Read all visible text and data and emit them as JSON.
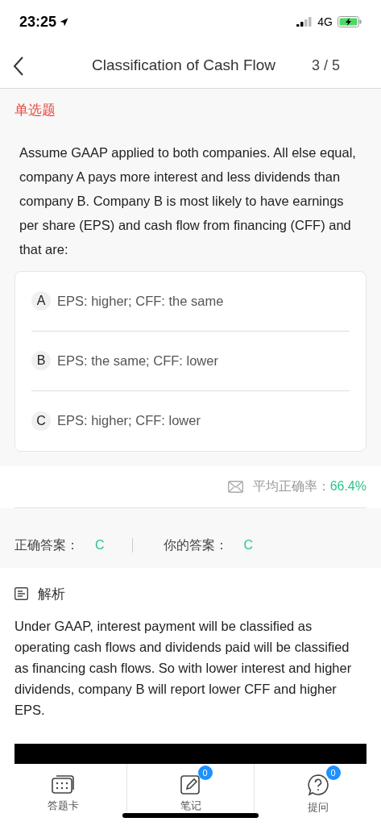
{
  "status_bar": {
    "time": "23:25",
    "network": "4G"
  },
  "nav": {
    "title": "Classification of Cash Flow",
    "progress": "3 / 5"
  },
  "question": {
    "type_label": "单选题",
    "text": "Assume GAAP applied to both companies. All else equal, company A pays more interest and less dividends than company B. Company B is most likely to have earnings per share (EPS) and cash flow from financing (CFF) and that are:",
    "options": [
      {
        "letter": "A",
        "text": "EPS: higher; CFF: the same"
      },
      {
        "letter": "B",
        "text": "EPS: the same; CFF: lower"
      },
      {
        "letter": "C",
        "text": "EPS: higher; CFF: lower"
      }
    ]
  },
  "stats": {
    "label": "平均正确率：",
    "value": "66.4%"
  },
  "answers": {
    "correct_label": "正确答案：",
    "correct": "C",
    "yours_label": "你的答案：",
    "yours": "C"
  },
  "analysis": {
    "title": "解析",
    "text": "Under GAAP, interest payment will be classified as operating cash flows and dividends paid will be classified as financing cash flows. So with lower interest and higher dividends, company B will report lower CFF and higher EPS."
  },
  "tab_bar": [
    {
      "kind": "card",
      "label": "答题卡"
    },
    {
      "kind": "note",
      "label": "笔记",
      "badge": "0"
    },
    {
      "kind": "ask",
      "label": "提问",
      "badge": "0"
    }
  ]
}
